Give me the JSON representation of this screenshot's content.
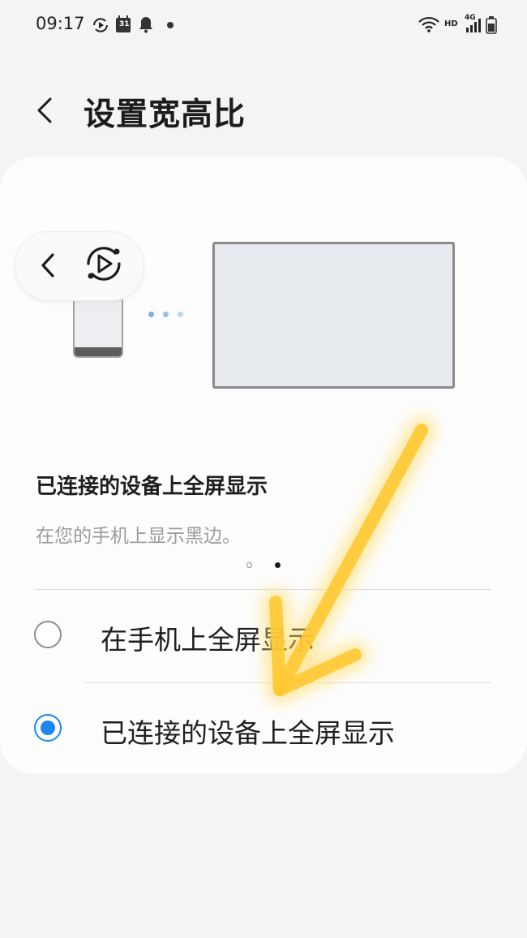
{
  "status_bar": {
    "time": "09:17",
    "calendar_day": "31",
    "network_hd": "HD",
    "network_4g": "4G",
    "icons": [
      "sync-play-icon",
      "calendar-icon",
      "bell-icon",
      "dot-icon",
      "wifi-icon",
      "signal-icon",
      "battery-icon"
    ]
  },
  "header": {
    "title": "设置宽高比",
    "back_icon": "back-chevron-icon"
  },
  "illustration": {
    "toolbar_icons": [
      "back-chevron-icon",
      "cast-play-icon"
    ]
  },
  "section": {
    "title": "已连接的设备上全屏显示",
    "description": "在您的手机上显示黑边。"
  },
  "pager": {
    "count": 2,
    "active_index": 1
  },
  "options": [
    {
      "label": "在手机上全屏显示",
      "selected": false
    },
    {
      "label": "已连接的设备上全屏显示",
      "selected": true
    }
  ],
  "colors": {
    "accent": "#1d87f1",
    "annotation_arrow": "#ffc933"
  }
}
